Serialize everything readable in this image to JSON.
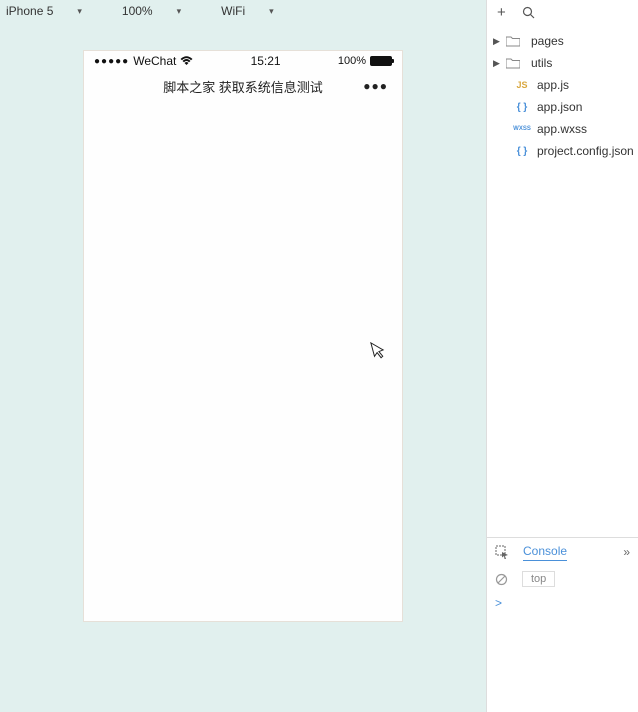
{
  "toolbar": {
    "device": "iPhone 5",
    "zoom": "100%",
    "network": "WiFi"
  },
  "sim": {
    "signal": "●●●●●",
    "carrier": "WeChat",
    "time": "15:21",
    "battery": "100%",
    "title": "脚本之家 获取系统信息测试",
    "menu": "●●●"
  },
  "tree": {
    "folders": [
      {
        "name": "pages"
      },
      {
        "name": "utils"
      }
    ],
    "files": [
      {
        "name": "app.js",
        "icon": "JS"
      },
      {
        "name": "app.json",
        "icon": "{ }"
      },
      {
        "name": "app.wxss",
        "icon": "WXSS"
      },
      {
        "name": "project.config.json",
        "icon": "{ }"
      }
    ]
  },
  "console": {
    "tab": "Console",
    "filter": "top",
    "prompt": ">"
  },
  "icons": {
    "plus": "+",
    "chevrons": "»"
  }
}
